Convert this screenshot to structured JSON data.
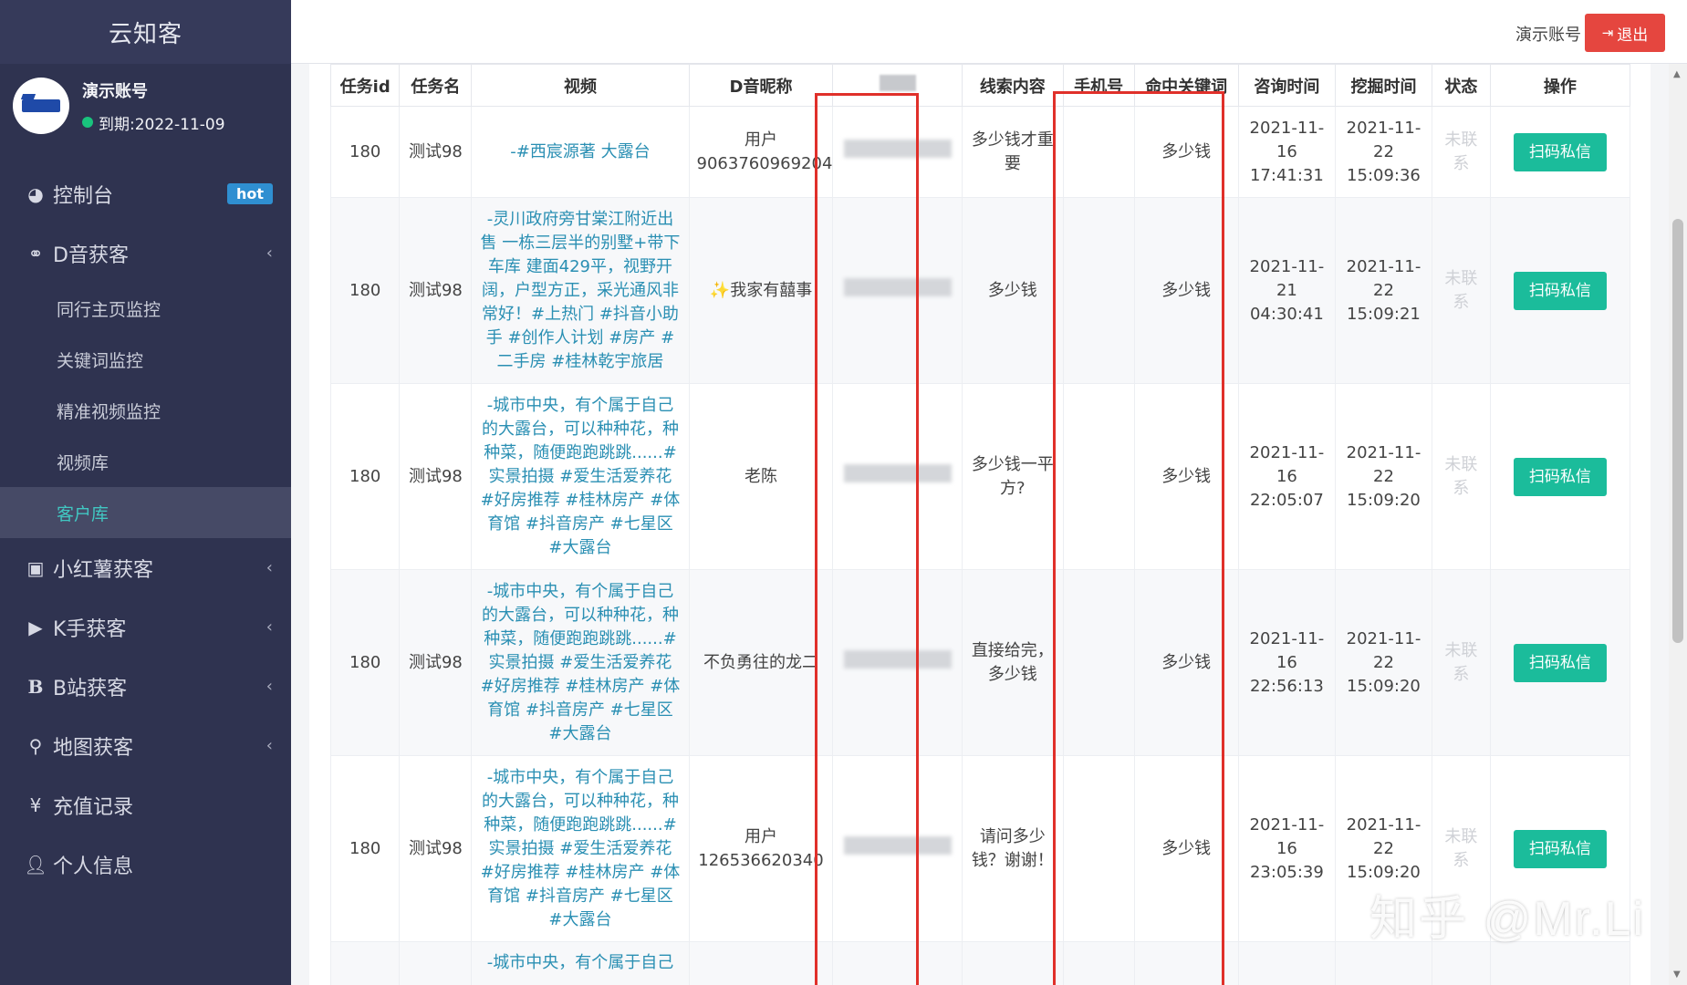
{
  "app": {
    "brand": "云知客"
  },
  "user": {
    "name": "演示账号",
    "expiry": "到期:2022-11-09"
  },
  "sidebar": {
    "items": [
      {
        "label": "控制台",
        "icon": "dashboard-icon",
        "badge": "hot"
      },
      {
        "label": "D音获客",
        "icon": "handshake-icon",
        "chevron": "‹",
        "children": [
          "同行主页监控",
          "关键词监控",
          "精准视频监控",
          "视频库",
          "客户库"
        ],
        "active": "客户库"
      },
      {
        "label": "小红薯获客",
        "icon": "contact-card-icon",
        "chevron": "‹"
      },
      {
        "label": "K手获客",
        "icon": "play-circle-icon",
        "chevron": "‹"
      },
      {
        "label": "B站获客",
        "icon": "b-letter-icon",
        "chevron": "‹"
      },
      {
        "label": "地图获客",
        "icon": "map-pin-icon",
        "chevron": "‹"
      },
      {
        "label": "充值记录",
        "icon": "yen-icon"
      },
      {
        "label": "个人信息",
        "icon": "user-icon"
      }
    ]
  },
  "header": {
    "account": "演示账号",
    "logout": "退出"
  },
  "table": {
    "columns": [
      "任务id",
      "任务名",
      "视频",
      "D音昵称",
      "",
      "线索内容",
      "手机号",
      "命中关键词",
      "咨询时间",
      "挖掘时间",
      "状态",
      "操作"
    ],
    "rows": [
      {
        "task_id": "180",
        "task_name": "测试98",
        "video": "-#西宸源著 大露台",
        "nickname": "用户9063760969204",
        "clue": "多少钱才重要",
        "phone": "",
        "keyword": "多少钱",
        "consult_time": "2021-11-16 17:41:31",
        "mine_time": "2021-11-22 15:09:36",
        "status": "未联系",
        "action": "扫码私信"
      },
      {
        "task_id": "180",
        "task_name": "测试98",
        "video": "-灵川政府旁甘棠江附近出售 一栋三层半的别墅+带下车库 建面429平，视野开阔，户型方正，采光通风非常好！#上热门 #抖音小助手 #创作人计划 #房产 #二手房 #桂林乾宇旅居",
        "nickname": "✨我家有囍事",
        "clue": "多少钱",
        "phone": "",
        "keyword": "多少钱",
        "consult_time": "2021-11-21 04:30:41",
        "mine_time": "2021-11-22 15:09:21",
        "status": "未联系",
        "action": "扫码私信"
      },
      {
        "task_id": "180",
        "task_name": "测试98",
        "video": "-城市中央，有个属于自己的大露台，可以种种花，种种菜，随便跑跑跳跳......#实景拍摄 #爱生活爱养花 #好房推荐 #桂林房产 #体育馆 #抖音房产 #七星区 #大露台",
        "nickname": "老陈",
        "clue": "多少钱一平方?",
        "phone": "",
        "keyword": "多少钱",
        "consult_time": "2021-11-16 22:05:07",
        "mine_time": "2021-11-22 15:09:20",
        "status": "未联系",
        "action": "扫码私信"
      },
      {
        "task_id": "180",
        "task_name": "测试98",
        "video": "-城市中央，有个属于自己的大露台，可以种种花，种种菜，随便跑跑跳跳......#实景拍摄 #爱生活爱养花 #好房推荐 #桂林房产 #体育馆 #抖音房产 #七星区 #大露台",
        "nickname": "不负勇往的龙二",
        "clue": "直接给完，多少钱",
        "phone": "",
        "keyword": "多少钱",
        "consult_time": "2021-11-16 22:56:13",
        "mine_time": "2021-11-22 15:09:20",
        "status": "未联系",
        "action": "扫码私信"
      },
      {
        "task_id": "180",
        "task_name": "测试98",
        "video": "-城市中央，有个属于自己的大露台，可以种种花，种种菜，随便跑跑跳跳......#实景拍摄 #爱生活爱养花 #好房推荐 #桂林房产 #体育馆 #抖音房产 #七星区 #大露台",
        "nickname": "用户126536620340",
        "clue": "请问多少钱？谢谢！",
        "phone": "",
        "keyword": "多少钱",
        "consult_time": "2021-11-16 23:05:39",
        "mine_time": "2021-11-22 15:09:20",
        "status": "未联系",
        "action": "扫码私信"
      },
      {
        "task_id": "",
        "task_name": "",
        "video": "-城市中央，有个属于自己",
        "nickname": "",
        "clue": "",
        "phone": "",
        "keyword": "",
        "consult_time": "",
        "mine_time": "",
        "status": "",
        "action": ""
      }
    ]
  },
  "watermark": "知乎 @Mr.Li",
  "colors": {
    "sidebar_bg": "#2f3350",
    "active_text": "#41c7c2",
    "button_green": "#1bbc9b",
    "logout_red": "#e5463f",
    "highlight_red": "#e0302a",
    "link_blue": "#2a8fb3"
  }
}
